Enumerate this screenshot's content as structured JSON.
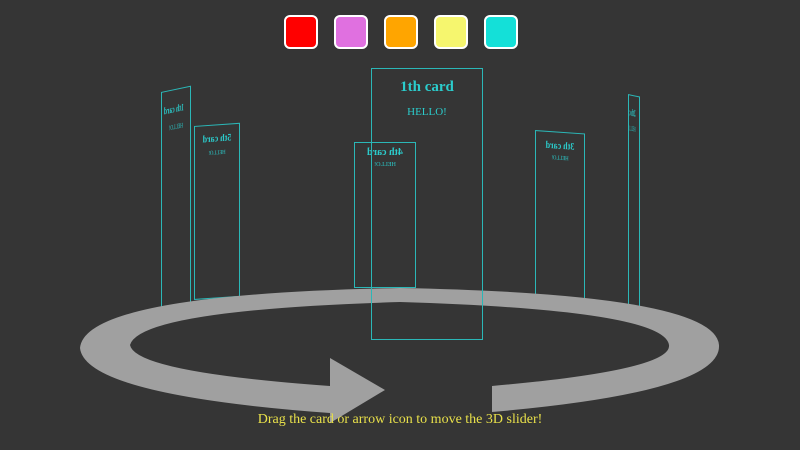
{
  "swatches": [
    {
      "name": "red",
      "color": "#ff0000"
    },
    {
      "name": "violet",
      "color": "#e070e0"
    },
    {
      "name": "orange",
      "color": "#ffa500"
    },
    {
      "name": "yellow",
      "color": "#f6f66e"
    },
    {
      "name": "turquoise",
      "color": "#14e0d8"
    }
  ],
  "cards": {
    "front": {
      "title": "1th card",
      "body": "HELLO!"
    },
    "left_back": {
      "title": "1th card",
      "body": "HELLO!"
    },
    "left_mid": {
      "title": "5th card",
      "body": "HELLO!"
    },
    "center_back": {
      "title": "4th card",
      "body": "HELLO!"
    },
    "right_mid": {
      "title": "3th card",
      "body": "HELLO!"
    },
    "right_back": {
      "title": "2th card",
      "body": "HELLO!"
    }
  },
  "hint": "Drag the card or arrow icon to move the 3D slider!",
  "colors": {
    "background": "#353535",
    "card_border": "#2bb7b7",
    "card_text": "#2bcccc",
    "arrow": "#a0a0a0",
    "hint_text": "#e8e04a"
  }
}
